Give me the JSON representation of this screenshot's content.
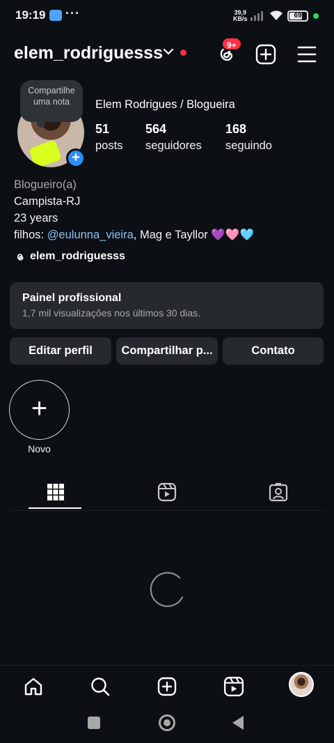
{
  "status_bar": {
    "time": "19:19",
    "dots": "···",
    "speed_value": "39,9",
    "speed_unit": "KB/s",
    "battery": "69",
    "battery_level": 0.69
  },
  "header": {
    "username": "elem_rodriguesss",
    "notification_badge": "9+"
  },
  "profile": {
    "note_text": "Compartilhe uma nota",
    "display_name": "Elem Rodrigues / Blogueira",
    "stats": [
      {
        "value": "51",
        "label": "posts"
      },
      {
        "value": "564",
        "label": "seguidores"
      },
      {
        "value": "168",
        "label": "seguindo"
      }
    ],
    "bio": {
      "category": "Blogueiro(a)",
      "line1": "Campista-RJ",
      "line2": "23 years",
      "line3_prefix": "filhos: ",
      "line3_mention": "@eulunna_vieira",
      "line3_suffix": ", Mag e Tayllor 💜🩷🩵"
    },
    "threads_handle": "elem_rodriguesss"
  },
  "dashboard": {
    "title": "Painel profissional",
    "subtitle": "1,7 mil visualizações nos últimos 30 dias."
  },
  "actions": {
    "edit": "Editar perfil",
    "share": "Compartilhar p...",
    "contact": "Contato"
  },
  "highlights": {
    "new_label": "Novo"
  },
  "tabs": {
    "active": "grid"
  },
  "colors": {
    "background": "#0c1014",
    "surface": "#262a2f",
    "accent_blue": "#2f8cf6",
    "badge_red": "#ff3040",
    "link_blue": "#8dbff7"
  },
  "icons": {
    "header": [
      "threads-icon",
      "add-content-icon",
      "menu-icon"
    ],
    "tabs": [
      "grid-icon",
      "reels-icon",
      "tagged-icon"
    ],
    "bottom_nav": [
      "home-icon",
      "search-icon",
      "create-icon",
      "reels-icon",
      "profile-avatar"
    ]
  }
}
